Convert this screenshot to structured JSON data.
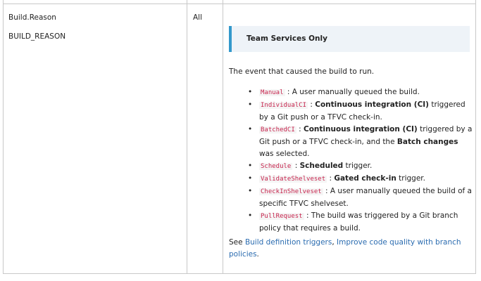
{
  "row": {
    "name_label": "Build.Reason",
    "env_label": "BUILD_REASON",
    "availability": "All",
    "callout_title": "Team Services Only",
    "intro": "The event that caused the build to run.",
    "items": [
      {
        "code": "Manual",
        "pre": " : A user manually queued the build.",
        "bold": "",
        "post": ""
      },
      {
        "code": "IndividualCI",
        "pre": " : ",
        "bold": "Continuous integration (CI)",
        "post": " triggered by a Git push or a TFVC check-in."
      },
      {
        "code": "BatchedCI",
        "pre": " : ",
        "bold": "Continuous integration (CI)",
        "post": " triggered by a Git push or a TFVC check-in, and the ",
        "bold2": "Batch changes",
        "post2": " was selected."
      },
      {
        "code": "Schedule",
        "pre": " : ",
        "bold": "Scheduled",
        "post": " trigger."
      },
      {
        "code": "ValidateShelveset",
        "pre": " : ",
        "bold": "Gated check-in",
        "post": " trigger."
      },
      {
        "code": "CheckInShelveset",
        "pre": " : A user manually queued the build of a specific TFVC shelveset.",
        "bold": "",
        "post": ""
      },
      {
        "code": "PullRequest",
        "pre": " : The build was triggered by a Git branch policy that requires a build.",
        "bold": "",
        "post": ""
      }
    ],
    "see_prefix": "See ",
    "link1": "Build definition triggers",
    "separator": ", ",
    "link2": "Improve code quality with branch policies",
    "see_suffix": "."
  },
  "bullet_char": "•",
  "colors": {
    "accent": "#3399cc",
    "link": "#2b6cb0",
    "code": "#c7254e"
  }
}
